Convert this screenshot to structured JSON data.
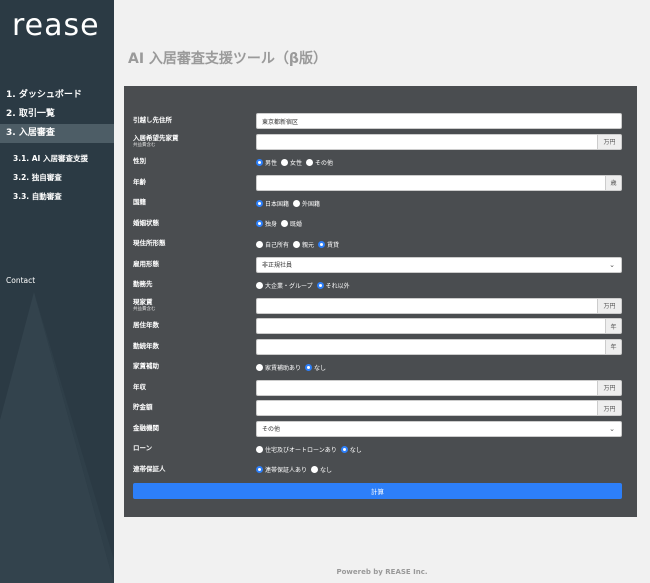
{
  "sidebar": {
    "logo": "rease",
    "nav": [
      {
        "label": "1. ダッシュボード"
      },
      {
        "label": "2. 取引一覧"
      },
      {
        "label": "3. 入居審査"
      }
    ],
    "sub": [
      {
        "label": "3.1. AI 入居審査支援"
      },
      {
        "label": "3.2. 独自審査"
      },
      {
        "label": "3.3. 自動審査"
      }
    ],
    "contact": "Contact"
  },
  "page": {
    "title": "AI 入居審査支援ツール（β版）"
  },
  "form": {
    "address": {
      "label": "引越し先住所",
      "value": "東京都新宿区"
    },
    "rent": {
      "label": "入居希望先家賃",
      "sub": "共益費含む",
      "value": "",
      "unit": "万円"
    },
    "gender": {
      "label": "性別",
      "options": [
        "男性",
        "女性",
        "その他"
      ],
      "selected": 0
    },
    "age": {
      "label": "年齢",
      "value": "",
      "unit": "歳"
    },
    "nationality": {
      "label": "国籍",
      "options": [
        "日本国籍",
        "外国籍"
      ],
      "selected": 0
    },
    "marital": {
      "label": "婚姻状態",
      "options": [
        "独身",
        "既婚"
      ],
      "selected": 0
    },
    "residence": {
      "label": "現住所形態",
      "options": [
        "自己所有",
        "親元",
        "賃貸"
      ],
      "selected": 2
    },
    "employment": {
      "label": "雇用形態",
      "value": "非正規社員"
    },
    "employer": {
      "label": "勤務先",
      "options": [
        "大企業・グループ",
        "それ以外"
      ],
      "selected": 1
    },
    "current_rent": {
      "label": "現家賃",
      "sub": "共益費含む",
      "value": "",
      "unit": "万円"
    },
    "years_residence": {
      "label": "居住年数",
      "value": "",
      "unit": "年"
    },
    "years_employment": {
      "label": "勤続年数",
      "value": "",
      "unit": "年"
    },
    "housing_aid": {
      "label": "家賃補助",
      "options": [
        "家賃補助あり",
        "なし"
      ],
      "selected": 1
    },
    "income": {
      "label": "年収",
      "value": "",
      "unit": "万円"
    },
    "savings": {
      "label": "貯金額",
      "value": "",
      "unit": "万円"
    },
    "bank": {
      "label": "金融機関",
      "value": "その他"
    },
    "loan": {
      "label": "ローン",
      "options": [
        "住宅及びオートローンあり",
        "なし"
      ],
      "selected": 1
    },
    "guarantor": {
      "label": "連帯保証人",
      "options": [
        "連帯保証人あり",
        "なし"
      ],
      "selected": 0
    },
    "submit": "計算"
  },
  "footer": "Powereb by REASE Inc."
}
